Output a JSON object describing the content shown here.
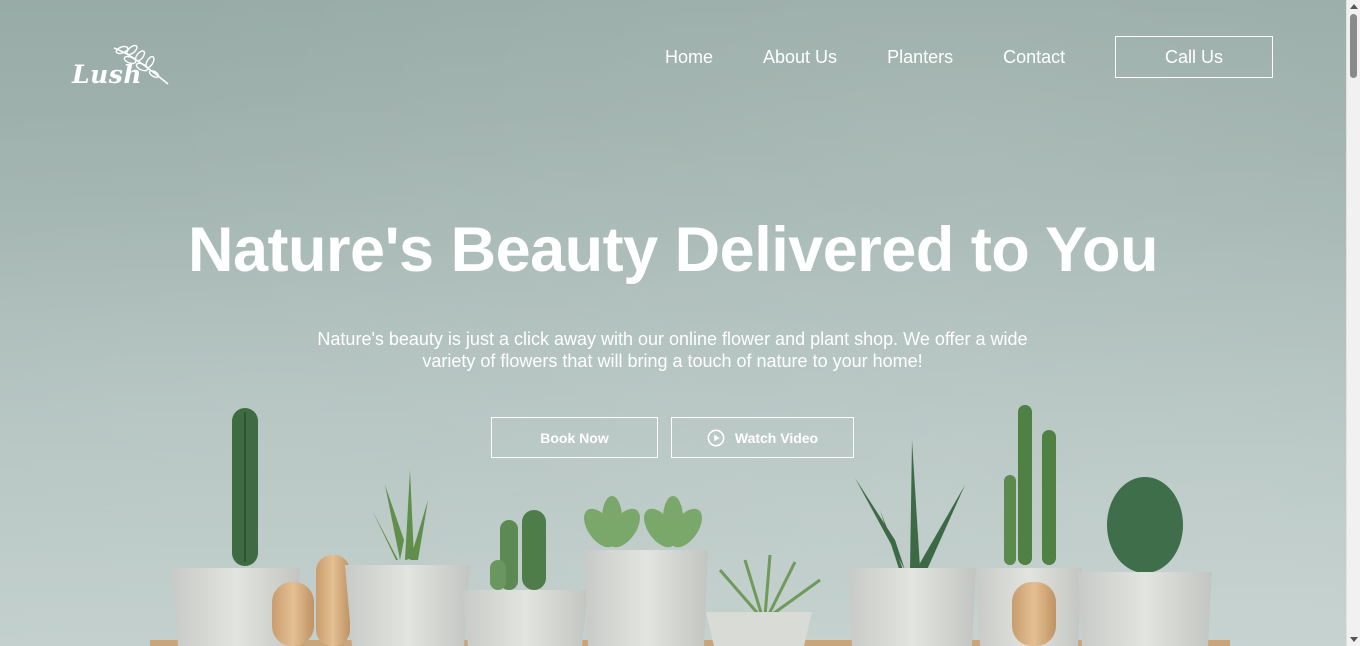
{
  "brand": {
    "logo_text": "Lush"
  },
  "nav": {
    "items": [
      {
        "label": "Home"
      },
      {
        "label": "About Us"
      },
      {
        "label": "Planters"
      },
      {
        "label": "Contact"
      }
    ],
    "cta_label": "Call Us"
  },
  "hero": {
    "title": "Nature's Beauty Delivered to You",
    "subtitle": "Nature's beauty is just a click away with our online flower and plant shop. We offer a wide variety of flowers that will bring a touch of nature to your home!",
    "book_label": "Book Now",
    "watch_label": "Watch Video",
    "watch_icon": "play-circle-icon"
  },
  "colors": {
    "background": "#a4b6b2",
    "text": "#ffffff",
    "plant_green": "#4f7a50",
    "pot": "#d6d8d4"
  }
}
